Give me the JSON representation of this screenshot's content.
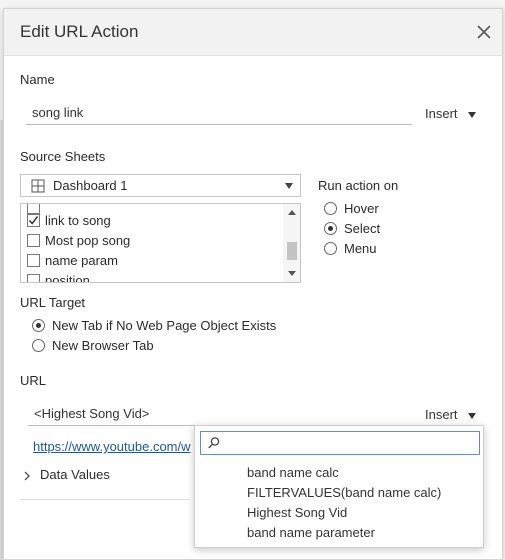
{
  "dialog": {
    "title": "Edit URL Action",
    "name_label": "Name",
    "name_value": "song link",
    "insert_label": "Insert",
    "source_sheets_label": "Source Sheets",
    "source_sheet_selected": "Dashboard 1",
    "sheet_items": [
      {
        "label": "link to song",
        "checked": true
      },
      {
        "label": "Most pop song",
        "checked": false
      },
      {
        "label": "name param",
        "checked": false
      },
      {
        "label": "position",
        "checked": false
      }
    ],
    "run_action_label": "Run action on",
    "run_options": [
      "Hover",
      "Select",
      "Menu"
    ],
    "run_selected": "Select",
    "url_target_label": "URL Target",
    "url_target_options": [
      "New Tab if No Web Page Object Exists",
      "New Browser Tab"
    ],
    "url_target_selected": "New Tab if No Web Page Object Exists",
    "url_label": "URL",
    "url_value": "<Highest Song Vid>",
    "url_preview": "https://www.youtube.com/w",
    "data_values_label": "Data Values"
  },
  "insert_menu": {
    "search_placeholder": "",
    "items": [
      "band name calc",
      "FILTERVALUES(band name calc)",
      "Highest Song Vid",
      "band name parameter"
    ]
  },
  "colors": {
    "header_bg": "#f2f2f2",
    "link": "#1a5a96",
    "search_border": "#5b8fd0"
  }
}
